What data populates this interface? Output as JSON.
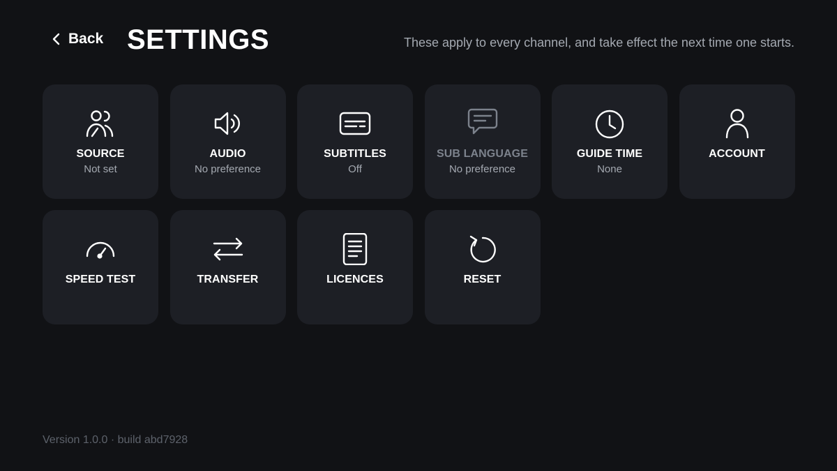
{
  "header": {
    "back_label": "Back",
    "title": "SETTINGS",
    "note": "These apply to every channel, and take effect the next time one starts.",
    "back_icon": "chevron-left-icon"
  },
  "tiles": [
    {
      "label": "SOURCE",
      "value": "Not set",
      "icon": "users-icon"
    },
    {
      "label": "AUDIO",
      "value": "No preference",
      "icon": "speaker-icon"
    },
    {
      "label": "SUBTITLES",
      "value": "Off",
      "icon": "subtitles-icon"
    },
    {
      "label": "SUB LANGUAGE",
      "value": "No preference",
      "icon": "chat-bubble-icon",
      "disabled": true
    },
    {
      "label": "GUIDE TIME",
      "value": "None",
      "icon": "clock-icon"
    },
    {
      "label": "ACCOUNT",
      "value": "",
      "icon": "user-icon"
    },
    {
      "label": "SPEED TEST",
      "value": "",
      "icon": "speedometer-icon"
    },
    {
      "label": "TRANSFER",
      "value": "",
      "icon": "transfer-arrows-icon"
    },
    {
      "label": "LICENCES",
      "value": "",
      "icon": "document-icon"
    },
    {
      "label": "RESET",
      "value": "",
      "icon": "reset-icon"
    }
  ],
  "footer": {
    "version": "Version 1.0.0 · build abd7928"
  },
  "colors": {
    "background": "#111215",
    "tile": "#1d1f25",
    "text_primary": "#ffffff",
    "text_secondary": "#a4a9b1",
    "text_disabled": "#7c828c",
    "text_footer": "#5d626b"
  }
}
